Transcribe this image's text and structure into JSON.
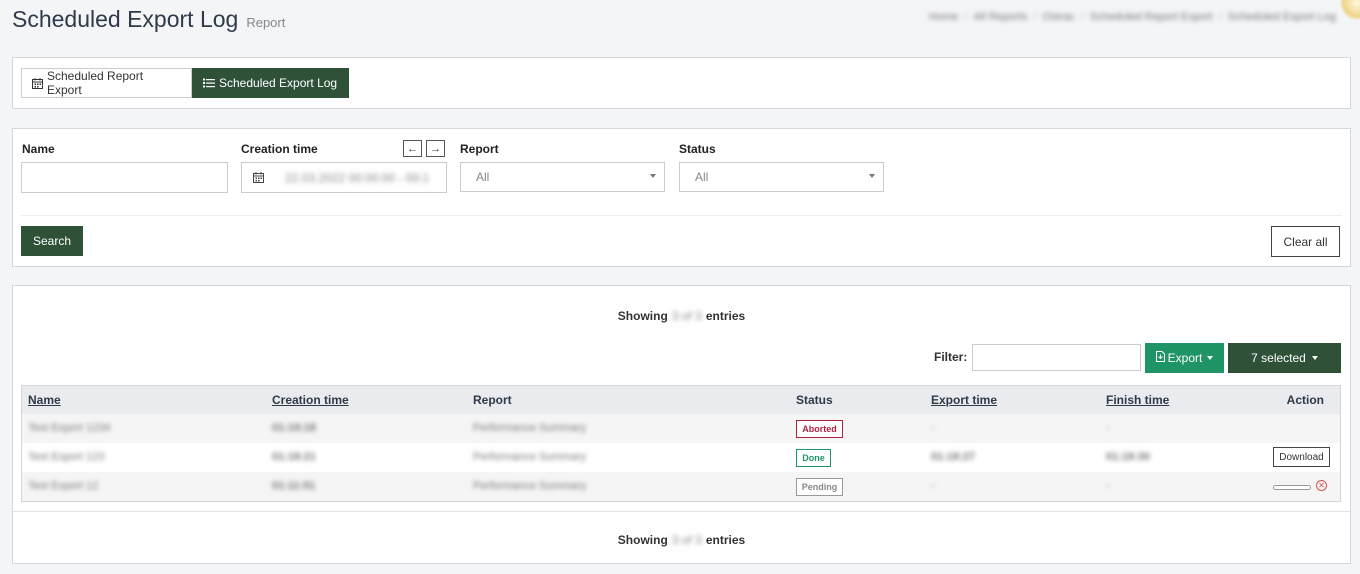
{
  "header": {
    "title": "Scheduled Export Log",
    "subtitle": "Report",
    "breadcrumb": [
      "Home",
      "All Reports",
      "Ostrac",
      "Scheduled Report Export",
      "Scheduled Export Log"
    ]
  },
  "tabs": [
    {
      "label": "Scheduled Report Export",
      "icon": "calendar-icon",
      "active": false
    },
    {
      "label": "Scheduled Export Log",
      "icon": "list-icon",
      "active": true
    }
  ],
  "filters": {
    "name_label": "Name",
    "name_value": "",
    "creation_label": "Creation time",
    "creation_value": "22.03.2022 00:00:00 - 00:1",
    "report_label": "Report",
    "report_value": "All",
    "status_label": "Status",
    "status_value": "All",
    "search_label": "Search",
    "clear_label": "Clear all"
  },
  "table_panel": {
    "showing_prefix": "Showing",
    "showing_count": "3 of 3",
    "showing_suffix": "entries",
    "filter_label": "Filter:",
    "filter_value": "",
    "export_label": "Export",
    "selected_label": "7 selected"
  },
  "table": {
    "columns": [
      "Name",
      "Creation time",
      "Report",
      "Status",
      "Export time",
      "Finish time",
      "Action"
    ],
    "rows": [
      {
        "name": "Test Export 1234",
        "creation": "01:19:18",
        "report": "Performance Summary",
        "status": "Aborted",
        "export": "-",
        "finish": "-",
        "action": ""
      },
      {
        "name": "Test Export 123",
        "creation": "01:18:21",
        "report": "Performance Summary",
        "status": "Done",
        "export": "01:18:27",
        "finish": "01:18:30",
        "action": "Download"
      },
      {
        "name": "Test Export 12",
        "creation": "01:11:51",
        "report": "Performance Summary",
        "status": "Pending",
        "export": "-",
        "finish": "-",
        "action": ""
      }
    ]
  },
  "colors": {
    "primary": "#2e5138",
    "export": "#1f9464",
    "aborted": "#b0213c",
    "done": "#1f9464",
    "pending": "#888888"
  }
}
